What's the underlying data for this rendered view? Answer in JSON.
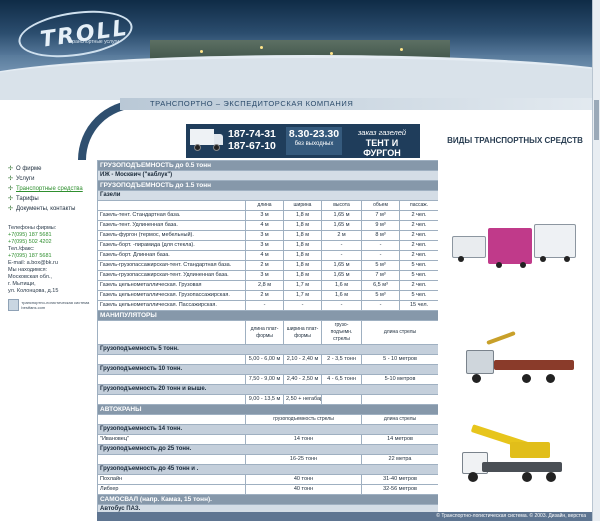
{
  "header": {
    "logo_text": "TROLL",
    "logo_subtitle": "транспортные услуги",
    "company_name": "ТРАНСПОРТНО – ЭКСПЕДИТОРСКАЯ КОМПАНИЯ"
  },
  "banner": {
    "phone1": "187-74-31",
    "phone2": "187-67-10",
    "hours": "8.30-23.30",
    "hours_note": "без выходных",
    "order_line1": "заказ газелей",
    "order_line2": "ТЕНТ И ФУРГОН"
  },
  "section_title": "ВИДЫ ТРАНСПОРТНЫХ СРЕДСТВ",
  "sidebar": {
    "items": [
      {
        "label": "О фирме"
      },
      {
        "label": "Услуги"
      },
      {
        "label": "Транспортные средства"
      },
      {
        "label": "Тарифы"
      },
      {
        "label": "Документы, контакты"
      }
    ],
    "phones_label": "Телефоны фирмы:",
    "phone1": "+7(095) 187 5681",
    "phone2": "+7(095) 502 4202",
    "fax_label": "Тел./факс:",
    "fax": "+7(095) 187 5681",
    "email": "E-mail: a.box@bk.ru",
    "location_label": "Мы находимся:",
    "location1": "Московская обл.,",
    "location2": "г. Мытищи,",
    "location3": "ул. Колонцова, д.15",
    "partner_text": "транспортно-логистическая система bestfans.com"
  },
  "table": {
    "g1": "ГРУЗОПОДЪЕМНОСТЬ до 0.5 тонн",
    "g1_row": "ИЖ - Москвич (\"каблук\")",
    "g2": "ГРУЗОПОДЪЕМНОСТЬ до 1.5 тонн",
    "gazeli": "Газели",
    "gazeli_head": [
      "длина",
      "ширина",
      "высота",
      "объем",
      "пасcаж."
    ],
    "gazeli_rows": [
      [
        "Газель-тент. Стандартная база.",
        "3 м",
        "1,8 м",
        "1,65 м",
        "7 м³",
        "2 чел."
      ],
      [
        "Газель-тент. Удлиненная база.",
        "4 м",
        "1,8 м",
        "1,65 м",
        "9 м³",
        "2 чел."
      ],
      [
        "Газель-фургон (термос, мебельный).",
        "3 м",
        "1,8 м",
        "2 м",
        "8 м³",
        "2 чел."
      ],
      [
        "Газель-борт. -пирамида (для стекла).",
        "3 м",
        "1,8 м",
        "-",
        "-",
        "2 чел."
      ],
      [
        "Газель-борт. Длинная база.",
        "4 м",
        "1,8 м",
        "-",
        "-",
        "2 чел."
      ],
      [
        "Газель-грузопассажирская-тент. Стандартная база.",
        "2 м",
        "1,8 м",
        "1,65 м",
        "5 м³",
        "5 чел."
      ],
      [
        "Газель-грузопассажирская-тент. Удлиненная база.",
        "3 м",
        "1,8 м",
        "1,65 м",
        "7 м³",
        "5 чел."
      ],
      [
        "Газель цельнометаллическая. Грузовая",
        "2,8 м",
        "1,7 м",
        "1,6 м",
        "6,5 м³",
        "2 чел."
      ],
      [
        "Газель цельнометаллическая. Грузопассажирская.",
        "2 м",
        "1,7 м",
        "1,6 м",
        "5 м³",
        "5 чел."
      ],
      [
        "Газель цельнометаллическая. Пассажирская.",
        "-",
        "-",
        "-",
        "-",
        "15 чел."
      ]
    ],
    "manip": "МАНИПУЛЯТОРЫ",
    "manip_head": [
      "длина плат-формы",
      "ширина плат-формы",
      "грузо-подъемн. стрелы",
      "длина стрелы"
    ],
    "manip_groups": [
      {
        "title": "Грузоподъемность 5 тонн.",
        "row": [
          "5,00 - 6,00 м",
          "2,10 - 2,40 м",
          "2 - 3,5 тонн",
          "5 - 10 метров"
        ]
      },
      {
        "title": "Грузоподъемность 10 тонн.",
        "row": [
          "7,50 - 9,00 м",
          "2,40 - 2,50 м",
          "4 - 6,5 тонн",
          "5-10 метров"
        ]
      },
      {
        "title": "Грузоподъемность 20 тонн и выше.",
        "row": [
          "9,00 - 13,5 м",
          "2,50 + негабарит",
          "",
          ""
        ]
      }
    ],
    "cranes": "АВТОКРАНЫ",
    "cranes_head": [
      "грузоподъемность стрелы",
      "длина стрелы"
    ],
    "crane_14": "Грузоподъемность 14 тонн.",
    "crane_14_row": [
      "\"Ивановец\"",
      "14 тонн",
      "14 метров"
    ],
    "crane_25": "Грузоподъемность до 25 тонн.",
    "crane_25_row": [
      "",
      "16-25 тонн",
      "22 метра"
    ],
    "crane_45": "Грузоподъемность до 45 тонн и .",
    "crane_45_rows": [
      [
        "Похлайн",
        "40 тонн",
        "31-40 метров"
      ],
      [
        "Либхер",
        "40 тонн",
        "32-56 метров"
      ]
    ],
    "dump": "САМОСВАЛ (напр. Камаз, 15 тонн).",
    "bus": "Автобус ПАЗ."
  },
  "footer": {
    "text": "© Транспортно-логистическая система. © 2003. Дизайн, верстка"
  },
  "colors": {
    "accent": "#2f8f2f",
    "header_dark": "#1f3d5b",
    "table_group": "#8698aa"
  }
}
